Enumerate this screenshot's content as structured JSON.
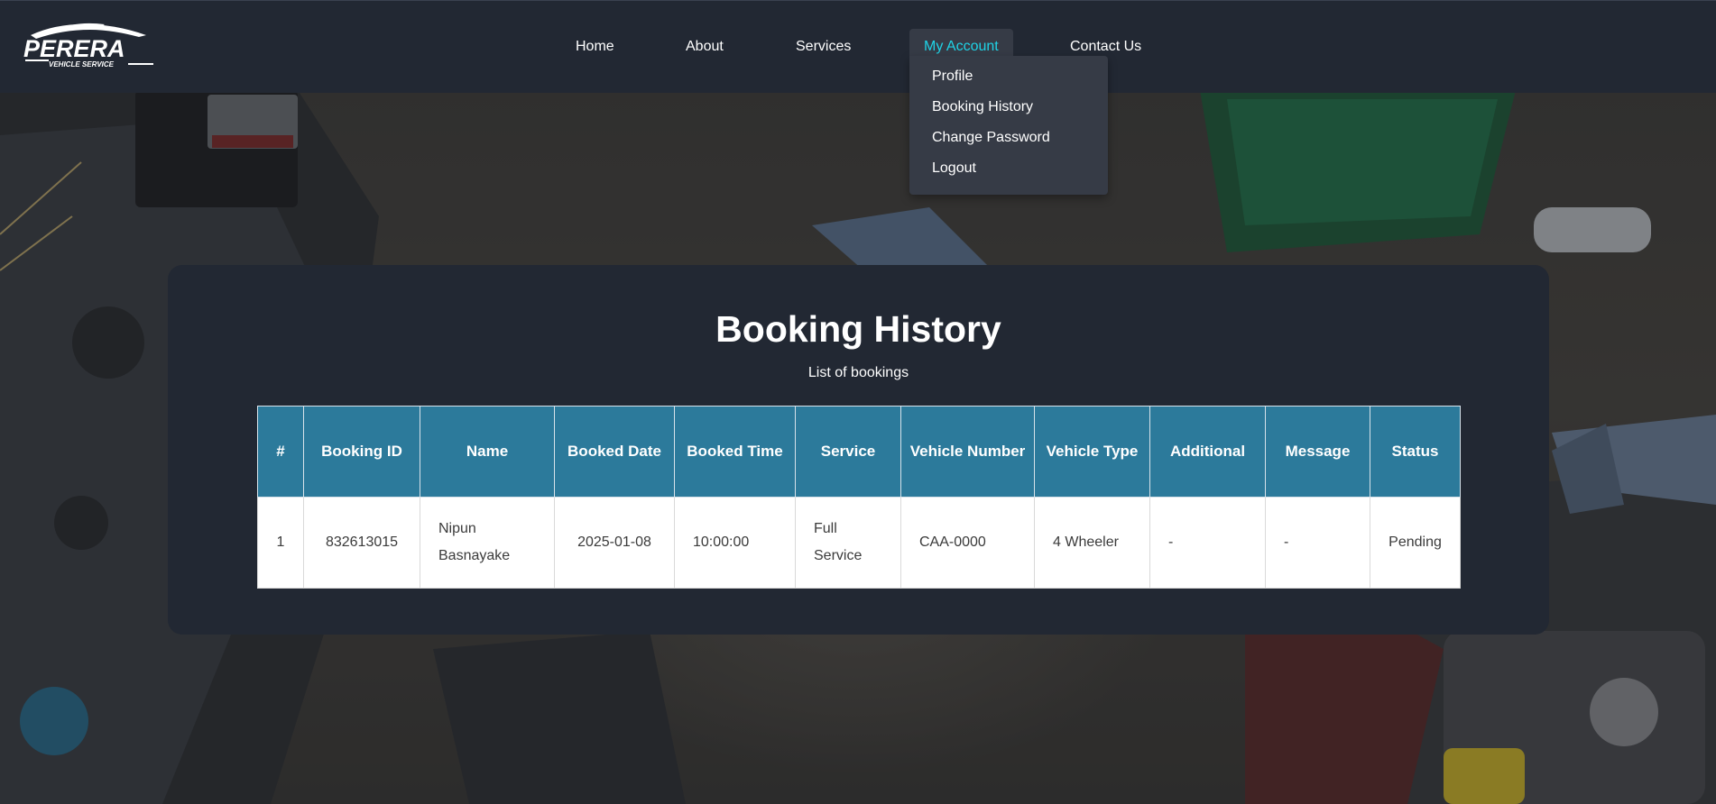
{
  "brand": {
    "logo_text": "PERERA",
    "logo_subtext": "VEHICLE SERVICE"
  },
  "nav": {
    "items": [
      {
        "label": "Home"
      },
      {
        "label": "About"
      },
      {
        "label": "Services"
      },
      {
        "label": "My Account",
        "active": true
      },
      {
        "label": "Contact Us"
      }
    ],
    "account_menu": [
      {
        "label": "Profile"
      },
      {
        "label": "Booking History"
      },
      {
        "label": "Change Password"
      },
      {
        "label": "Logout"
      }
    ]
  },
  "main": {
    "title": "Booking History",
    "subtitle": "List of bookings"
  },
  "table": {
    "headers": [
      "#",
      "Booking ID",
      "Name",
      "Booked Date",
      "Booked Time",
      "Service",
      "Vehicle Number",
      "Vehicle Type",
      "Additional",
      "Message",
      "Status"
    ],
    "rows": [
      [
        "1",
        "832613015",
        "Nipun Basnayake",
        "2025-01-08",
        "10:00:00",
        "Full Service",
        "CAA-0000",
        "4 Wheeler",
        "-",
        "-",
        "Pending"
      ]
    ]
  },
  "colors": {
    "navbar_bg": "#222833",
    "card_bg": "#222833",
    "active_link": "#1fd3e6",
    "dropdown_bg": "#363b46",
    "table_header_bg": "#2c7a9b"
  }
}
